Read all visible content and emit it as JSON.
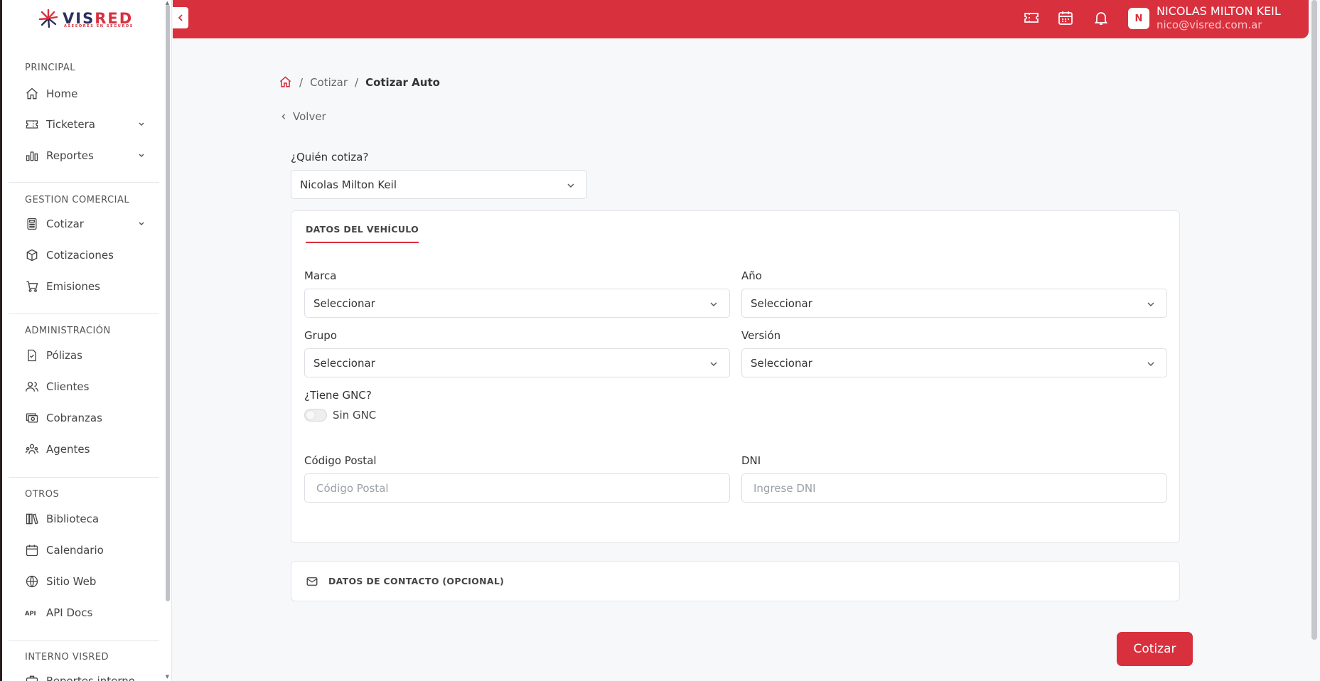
{
  "brand": {
    "logo_main": "VIS",
    "logo_accent": "RED",
    "logo_sub": "ASESORES EN SEGUROS"
  },
  "sidebar": {
    "sections": {
      "principal": "PRINCIPAL",
      "gestion": "GESTION COMERCIAL",
      "admin": "ADMINISTRACIÓN",
      "otros": "OTROS",
      "interno": "INTERNO VISRED"
    },
    "items": {
      "home": "Home",
      "ticketera": "Ticketera",
      "reportes": "Reportes",
      "cotizar": "Cotizar",
      "cotizaciones": "Cotizaciones",
      "emisiones": "Emisiones",
      "polizas": "Pólizas",
      "clientes": "Clientes",
      "cobranzas": "Cobranzas",
      "agentes": "Agentes",
      "biblioteca": "Biblioteca",
      "calendario": "Calendario",
      "sitio_web": "Sitio Web",
      "api_docs": "API Docs",
      "reportes_interno": "Reportes interno"
    }
  },
  "topbar": {
    "avatar_initial": "N",
    "user_name": "NICOLAS MILTON KEIL",
    "user_email": "nico@visred.com.ar"
  },
  "breadcrumb": {
    "level1": "Cotizar",
    "current": "Cotizar Auto",
    "sep": "/"
  },
  "back_label": "Volver",
  "quien_cotiza": {
    "label": "¿Quién cotiza?",
    "value": "Nicolas Milton Keil"
  },
  "vehiculo": {
    "tab_label": "DATOS DEL VEHÍCULO",
    "marca": {
      "label": "Marca",
      "value": "Seleccionar"
    },
    "anio": {
      "label": "Año",
      "value": "Seleccionar"
    },
    "grupo": {
      "label": "Grupo",
      "value": "Seleccionar"
    },
    "version": {
      "label": "Versión",
      "value": "Seleccionar"
    },
    "gnc": {
      "label": "¿Tiene GNC?",
      "toggle_label": "Sin GNC"
    },
    "codigo_postal": {
      "label": "Código Postal",
      "placeholder": "Código Postal"
    },
    "dni": {
      "label": "DNI",
      "placeholder": "Ingrese DNI"
    }
  },
  "contacto": {
    "title": "DATOS DE CONTACTO (OPCIONAL)"
  },
  "submit_label": "Cotizar",
  "colors": {
    "accent": "#d9303e",
    "navy": "#2a2f5c"
  }
}
